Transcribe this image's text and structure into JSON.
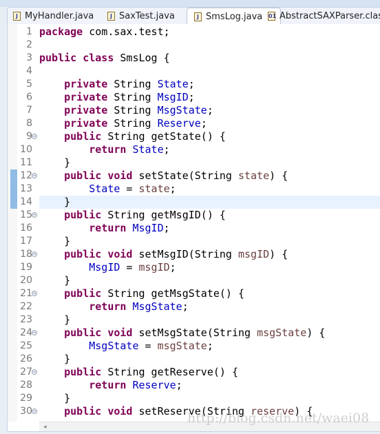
{
  "tabs": [
    {
      "label": "MyHandler.java",
      "icon": "java-file-icon",
      "active": false
    },
    {
      "label": "SaxTest.java",
      "icon": "java-file-warning-icon",
      "active": false
    },
    {
      "label": "SmsLog.java",
      "icon": "java-file-icon",
      "active": true,
      "close": "⊠"
    },
    {
      "label": "AbstractSAXParser.class",
      "icon": "class-file-icon",
      "active": false
    }
  ],
  "current_line": 14,
  "changed_lines": [
    12,
    13,
    14
  ],
  "fold_lines": [
    9,
    12,
    15,
    18,
    21,
    24,
    27,
    30
  ],
  "colors": {
    "keyword": "#7f0055",
    "field": "#0000c0",
    "param": "#6a3e3e",
    "current_line": "#e8f2fe"
  },
  "lines": [
    [
      [
        "kw",
        "package"
      ],
      [
        "t",
        " com.sax.test;"
      ]
    ],
    [],
    [
      [
        "kw",
        "public"
      ],
      [
        "t",
        " "
      ],
      [
        "kw",
        "class"
      ],
      [
        "t",
        " SmsLog {"
      ]
    ],
    [],
    [
      [
        "t",
        "    "
      ],
      [
        "kw",
        "private"
      ],
      [
        "t",
        " String "
      ],
      [
        "fd",
        "State"
      ],
      [
        "t",
        ";"
      ]
    ],
    [
      [
        "t",
        "    "
      ],
      [
        "kw",
        "private"
      ],
      [
        "t",
        " String "
      ],
      [
        "fd",
        "MsgID"
      ],
      [
        "t",
        ";"
      ]
    ],
    [
      [
        "t",
        "    "
      ],
      [
        "kw",
        "private"
      ],
      [
        "t",
        " String "
      ],
      [
        "fd",
        "MsgState"
      ],
      [
        "t",
        ";"
      ]
    ],
    [
      [
        "t",
        "    "
      ],
      [
        "kw",
        "private"
      ],
      [
        "t",
        " String "
      ],
      [
        "fd",
        "Reserve"
      ],
      [
        "t",
        ";"
      ]
    ],
    [
      [
        "t",
        "    "
      ],
      [
        "kw",
        "public"
      ],
      [
        "t",
        " String getState() {"
      ]
    ],
    [
      [
        "t",
        "        "
      ],
      [
        "kw",
        "return"
      ],
      [
        "t",
        " "
      ],
      [
        "fd",
        "State"
      ],
      [
        "t",
        ";"
      ]
    ],
    [
      [
        "t",
        "    }"
      ]
    ],
    [
      [
        "t",
        "    "
      ],
      [
        "kw",
        "public"
      ],
      [
        "t",
        " "
      ],
      [
        "kw",
        "void"
      ],
      [
        "t",
        " setState(String "
      ],
      [
        "pm",
        "state"
      ],
      [
        "t",
        ") {"
      ]
    ],
    [
      [
        "t",
        "        "
      ],
      [
        "fd",
        "State"
      ],
      [
        "t",
        " = "
      ],
      [
        "pm",
        "state"
      ],
      [
        "t",
        ";"
      ]
    ],
    [
      [
        "t",
        "    }"
      ]
    ],
    [
      [
        "t",
        "    "
      ],
      [
        "kw",
        "public"
      ],
      [
        "t",
        " String getMsgID() {"
      ]
    ],
    [
      [
        "t",
        "        "
      ],
      [
        "kw",
        "return"
      ],
      [
        "t",
        " "
      ],
      [
        "fd",
        "MsgID"
      ],
      [
        "t",
        ";"
      ]
    ],
    [
      [
        "t",
        "    }"
      ]
    ],
    [
      [
        "t",
        "    "
      ],
      [
        "kw",
        "public"
      ],
      [
        "t",
        " "
      ],
      [
        "kw",
        "void"
      ],
      [
        "t",
        " setMsgID(String "
      ],
      [
        "pm",
        "msgID"
      ],
      [
        "t",
        ") {"
      ]
    ],
    [
      [
        "t",
        "        "
      ],
      [
        "fd",
        "MsgID"
      ],
      [
        "t",
        " = "
      ],
      [
        "pm",
        "msgID"
      ],
      [
        "t",
        ";"
      ]
    ],
    [
      [
        "t",
        "    }"
      ]
    ],
    [
      [
        "t",
        "    "
      ],
      [
        "kw",
        "public"
      ],
      [
        "t",
        " String getMsgState() {"
      ]
    ],
    [
      [
        "t",
        "        "
      ],
      [
        "kw",
        "return"
      ],
      [
        "t",
        " "
      ],
      [
        "fd",
        "MsgState"
      ],
      [
        "t",
        ";"
      ]
    ],
    [
      [
        "t",
        "    }"
      ]
    ],
    [
      [
        "t",
        "    "
      ],
      [
        "kw",
        "public"
      ],
      [
        "t",
        " "
      ],
      [
        "kw",
        "void"
      ],
      [
        "t",
        " setMsgState(String "
      ],
      [
        "pm",
        "msgState"
      ],
      [
        "t",
        ") {"
      ]
    ],
    [
      [
        "t",
        "        "
      ],
      [
        "fd",
        "MsgState"
      ],
      [
        "t",
        " = "
      ],
      [
        "pm",
        "msgState"
      ],
      [
        "t",
        ";"
      ]
    ],
    [
      [
        "t",
        "    }"
      ]
    ],
    [
      [
        "t",
        "    "
      ],
      [
        "kw",
        "public"
      ],
      [
        "t",
        " String getReserve() {"
      ]
    ],
    [
      [
        "t",
        "        "
      ],
      [
        "kw",
        "return"
      ],
      [
        "t",
        " "
      ],
      [
        "fd",
        "Reserve"
      ],
      [
        "t",
        ";"
      ]
    ],
    [
      [
        "t",
        "    }"
      ]
    ],
    [
      [
        "t",
        "    "
      ],
      [
        "kw",
        "public"
      ],
      [
        "t",
        " "
      ],
      [
        "kw",
        "void"
      ],
      [
        "t",
        " setReserve(String "
      ],
      [
        "pm",
        "reserve"
      ],
      [
        "t",
        ") {"
      ]
    ]
  ],
  "scroll_left_arrow": "◂",
  "watermark": "http://blog.csdn.net/waei08"
}
